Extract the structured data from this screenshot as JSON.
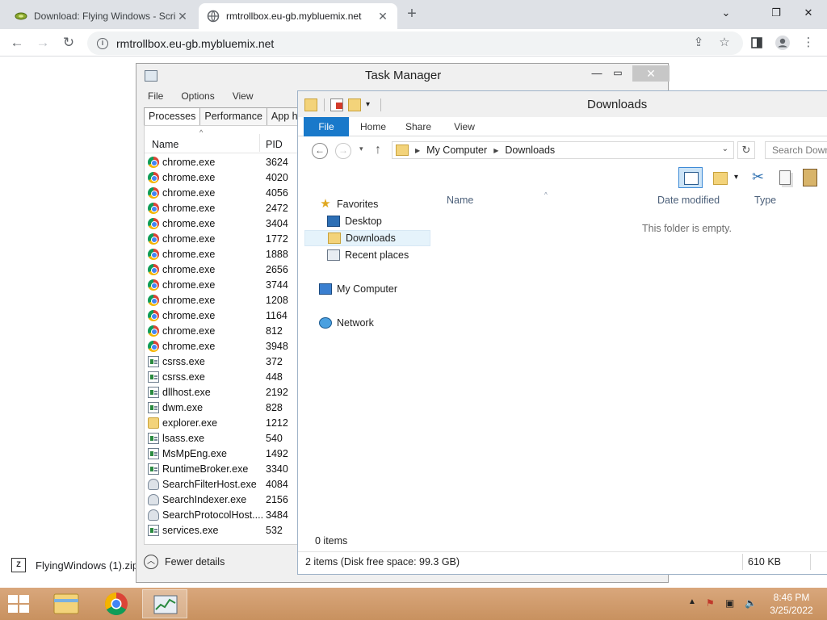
{
  "browser": {
    "tabs": [
      {
        "title": "Download: Flying Windows - Scri",
        "active": false
      },
      {
        "title": "rmtrollbox.eu-gb.mybluemix.net",
        "active": true
      }
    ],
    "new_tab": "+",
    "window_controls": {
      "min": "⌄",
      "max": "❐",
      "close": "✕"
    },
    "url": "rmtrollbox.eu-gb.mybluemix.net",
    "download_item": "FlyingWindows (1).zip"
  },
  "task_manager": {
    "title": "Task Manager",
    "menu": [
      "File",
      "Options",
      "View"
    ],
    "tabs": [
      "Processes",
      "Performance",
      "App his"
    ],
    "columns": {
      "name": "Name",
      "pid": "PID"
    },
    "processes": [
      {
        "name": "chrome.exe",
        "pid": "3624",
        "icon": "chrome"
      },
      {
        "name": "chrome.exe",
        "pid": "4020",
        "icon": "chrome"
      },
      {
        "name": "chrome.exe",
        "pid": "4056",
        "icon": "chrome"
      },
      {
        "name": "chrome.exe",
        "pid": "2472",
        "icon": "chrome"
      },
      {
        "name": "chrome.exe",
        "pid": "3404",
        "icon": "chrome"
      },
      {
        "name": "chrome.exe",
        "pid": "1772",
        "icon": "chrome"
      },
      {
        "name": "chrome.exe",
        "pid": "1888",
        "icon": "chrome"
      },
      {
        "name": "chrome.exe",
        "pid": "2656",
        "icon": "chrome"
      },
      {
        "name": "chrome.exe",
        "pid": "3744",
        "icon": "chrome"
      },
      {
        "name": "chrome.exe",
        "pid": "1208",
        "icon": "chrome"
      },
      {
        "name": "chrome.exe",
        "pid": "1164",
        "icon": "chrome"
      },
      {
        "name": "chrome.exe",
        "pid": "812",
        "icon": "chrome"
      },
      {
        "name": "chrome.exe",
        "pid": "3948",
        "icon": "chrome"
      },
      {
        "name": "csrss.exe",
        "pid": "372",
        "icon": "box"
      },
      {
        "name": "csrss.exe",
        "pid": "448",
        "icon": "box"
      },
      {
        "name": "dllhost.exe",
        "pid": "2192",
        "icon": "box"
      },
      {
        "name": "dwm.exe",
        "pid": "828",
        "icon": "box"
      },
      {
        "name": "explorer.exe",
        "pid": "1212",
        "icon": "folder"
      },
      {
        "name": "lsass.exe",
        "pid": "540",
        "icon": "box"
      },
      {
        "name": "MsMpEng.exe",
        "pid": "1492",
        "icon": "box"
      },
      {
        "name": "RuntimeBroker.exe",
        "pid": "3340",
        "icon": "box"
      },
      {
        "name": "SearchFilterHost.exe",
        "pid": "4084",
        "icon": "person"
      },
      {
        "name": "SearchIndexer.exe",
        "pid": "2156",
        "icon": "person"
      },
      {
        "name": "SearchProtocolHost....",
        "pid": "3484",
        "icon": "person"
      },
      {
        "name": "services.exe",
        "pid": "532",
        "icon": "box"
      }
    ],
    "fewer_details": "Fewer details"
  },
  "explorer": {
    "title": "Downloads",
    "ribbon_tabs": [
      "File",
      "Home",
      "Share",
      "View"
    ],
    "breadcrumb": [
      "My Computer",
      "Downloads"
    ],
    "search_placeholder": "Search Down",
    "nav": {
      "favorites": "Favorites",
      "desktop": "Desktop",
      "downloads": "Downloads",
      "recent": "Recent places",
      "computer": "My Computer",
      "network": "Network"
    },
    "columns": {
      "name": "Name",
      "date": "Date modified",
      "type": "Type"
    },
    "empty_message": "This folder is empty.",
    "item_count": "0 items",
    "status_left": "2 items (Disk free space: 99.3 GB)",
    "status_size": "610 KB"
  },
  "taskbar": {
    "time": "8:46 PM",
    "date": "3/25/2022"
  }
}
